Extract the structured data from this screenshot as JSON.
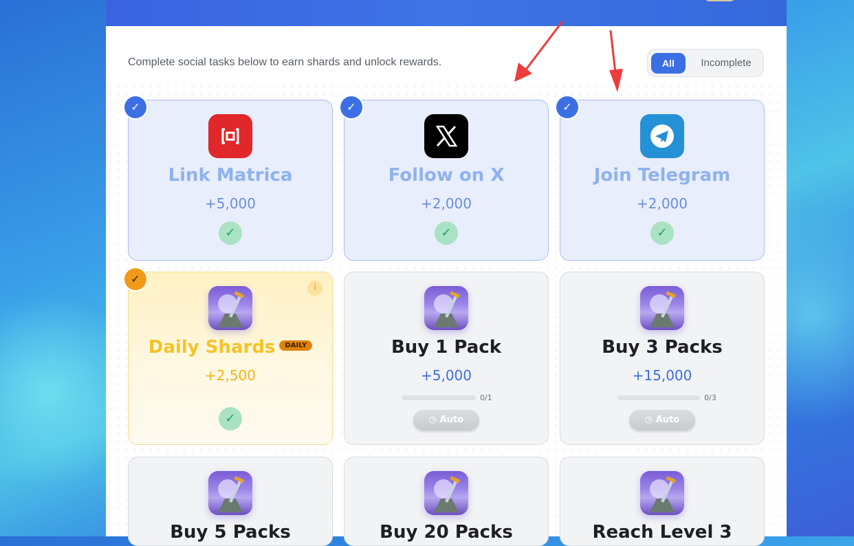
{
  "intro": "Complete social tasks below to earn shards and unlock rewards.",
  "filter": {
    "all": "All",
    "incomplete": "Incomplete"
  },
  "tasks": [
    {
      "title": "Link Matrica",
      "reward": "+5,000",
      "status": "completed",
      "icon": "matrica-icon"
    },
    {
      "title": "Follow on X",
      "reward": "+2,000",
      "status": "completed",
      "icon": "x-logo-icon"
    },
    {
      "title": "Join Telegram",
      "reward": "+2,000",
      "status": "completed",
      "icon": "telegram-icon"
    },
    {
      "title": "Daily Shards",
      "tag": "DAILY",
      "reward": "+2,500",
      "status": "completed",
      "icon": "sword-game-icon"
    },
    {
      "title": "Buy 1 Pack",
      "reward": "+5,000",
      "progress": "0/1",
      "button": "Auto",
      "icon": "sword-game-icon"
    },
    {
      "title": "Buy 3 Packs",
      "reward": "+15,000",
      "progress": "0/3",
      "button": "Auto",
      "icon": "sword-game-icon"
    },
    {
      "title": "Buy 5 Packs",
      "icon": "sword-game-icon"
    },
    {
      "title": "Buy 20 Packs",
      "icon": "sword-game-icon"
    },
    {
      "title": "Reach Level 3",
      "icon": "sword-game-icon"
    }
  ],
  "colors": {
    "accent": "#3c6ee4",
    "daily": "#f2b41a",
    "done_bg": "#e9eefc",
    "success": "#22a05c",
    "arrow": "#ee3b3b"
  }
}
